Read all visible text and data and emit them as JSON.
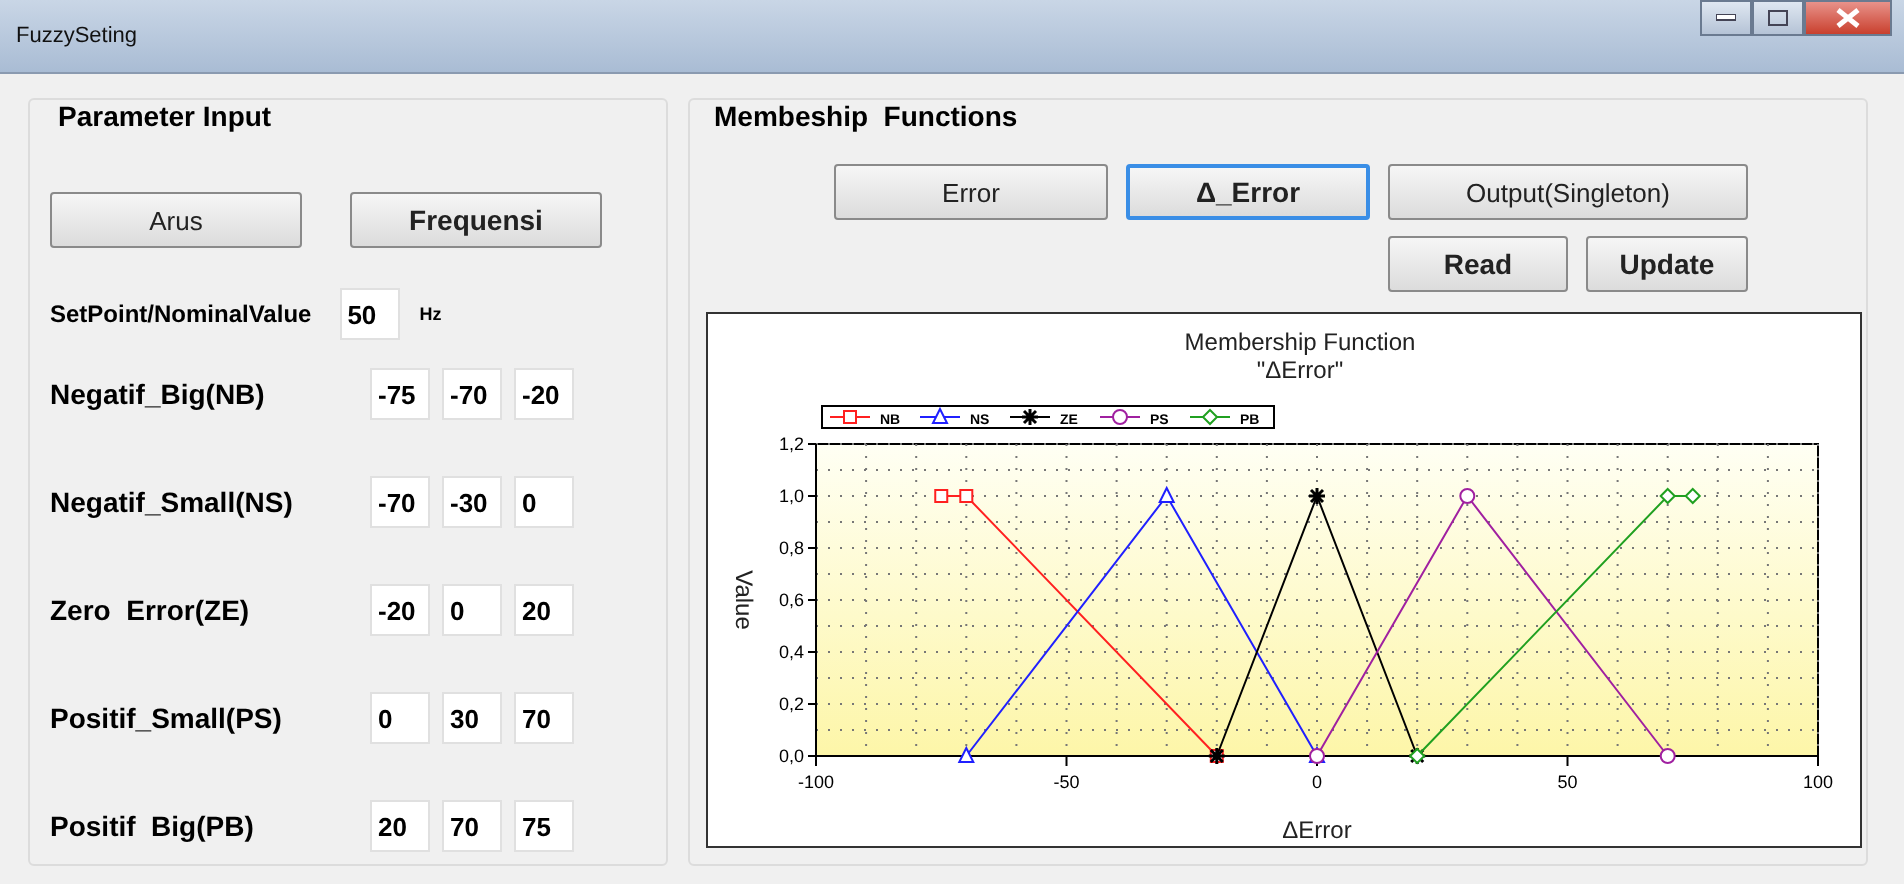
{
  "window": {
    "title": "FuzzySeting"
  },
  "parameter_input": {
    "title": "Parameter Input",
    "mode_buttons": [
      {
        "label": "Arus",
        "selected": false
      },
      {
        "label": "Frequensi",
        "selected": true
      }
    ],
    "setpoint": {
      "label": "SetPoint/NominalValue",
      "value": "50",
      "unit": "Hz"
    },
    "rows": [
      {
        "label": "Negatif_Big(NB)",
        "values": [
          "-75",
          "-70",
          "-20"
        ]
      },
      {
        "label": "Negatif_Small(NS)",
        "values": [
          "-70",
          "-30",
          "0"
        ]
      },
      {
        "label": "Zero  Error(ZE)",
        "values": [
          "-20",
          "0",
          "20"
        ]
      },
      {
        "label": "Positif_Small(PS)",
        "values": [
          "0",
          "30",
          "70"
        ]
      },
      {
        "label": "Positif  Big(PB)",
        "values": [
          "20",
          "70",
          "75"
        ]
      }
    ]
  },
  "membership": {
    "title": "Membeship  Functions",
    "type_buttons": [
      {
        "label": "Error",
        "selected": false
      },
      {
        "label": "Δ_Error",
        "selected": true
      },
      {
        "label": "Output(Singleton)",
        "selected": false
      }
    ],
    "action_buttons": [
      "Read",
      "Update"
    ],
    "chart_data": {
      "type": "line",
      "title": "Membership Function\n\"ΔError\"",
      "xlabel": "ΔError",
      "ylabel": "Value",
      "xlim": [
        -100,
        100
      ],
      "ylim": [
        0,
        1.2
      ],
      "grid": true,
      "legend": true,
      "x": [
        -75,
        -70,
        -30,
        -20,
        0,
        20,
        30,
        70,
        75
      ],
      "xticks": [
        -100,
        -50,
        0,
        50,
        100
      ],
      "yticks": [
        {
          "value": 0,
          "label": "0,0"
        },
        {
          "value": 0.2,
          "label": "0,2"
        },
        {
          "value": 0.4,
          "label": "0,4"
        },
        {
          "value": 0.6,
          "label": "0,6"
        },
        {
          "value": 0.8,
          "label": "0,8"
        },
        {
          "value": 1,
          "label": "1,0"
        },
        {
          "value": 1.2,
          "label": "1,2"
        }
      ],
      "series": [
        {
          "name": "NB",
          "color": "#ff2020",
          "marker": "square",
          "values": [
            1,
            1,
            null,
            0,
            null,
            null,
            null,
            null,
            null
          ]
        },
        {
          "name": "NS",
          "color": "#2020ff",
          "marker": "triangle",
          "values": [
            null,
            0,
            1,
            null,
            0,
            null,
            null,
            null,
            null
          ]
        },
        {
          "name": "ZE",
          "color": "#000000",
          "marker": "cross",
          "values": [
            null,
            null,
            null,
            0,
            1,
            0,
            null,
            null,
            null
          ]
        },
        {
          "name": "PS",
          "color": "#a020a0",
          "marker": "circle",
          "values": [
            null,
            null,
            null,
            null,
            0,
            null,
            1,
            0,
            null
          ]
        },
        {
          "name": "PB",
          "color": "#20a020",
          "marker": "diamond",
          "values": [
            null,
            null,
            null,
            null,
            null,
            0,
            null,
            1,
            1
          ]
        }
      ]
    }
  }
}
